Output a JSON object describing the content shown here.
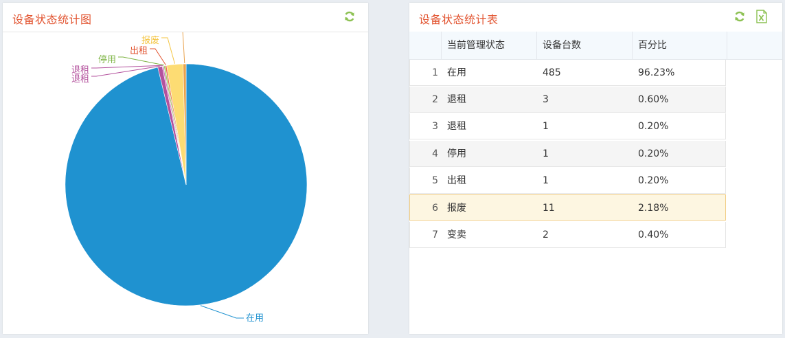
{
  "left_panel": {
    "title": "设备状态统计图",
    "refresh_icon": "refresh-icon"
  },
  "right_panel": {
    "title": "设备状态统计表",
    "refresh_icon": "refresh-icon",
    "export_icon": "excel-export-icon"
  },
  "colors": {
    "title": "#e2532f",
    "icon_green": "#8cc152",
    "slice_main": "#1f92d0"
  },
  "chart_data": {
    "type": "pie",
    "labels": [
      "在用",
      "退租",
      "退租",
      "停用",
      "出租",
      "报废",
      "变卖"
    ],
    "values": [
      485,
      3,
      1,
      1,
      1,
      11,
      2
    ],
    "colors": [
      "#1f92d0",
      "#b3519d",
      "#d37ec4",
      "#9cd160",
      "#ea6d48",
      "#fddc73",
      "#e8a24d"
    ],
    "label_colors": [
      "#1f92d0",
      "#b3519d",
      "#b3519d",
      "#7cb342",
      "#e2532f",
      "#f4c542",
      "#e8a24d"
    ]
  },
  "table": {
    "columns": [
      "当前管理状态",
      "设备台数",
      "百分比"
    ],
    "rows": [
      {
        "idx": "1",
        "status": "在用",
        "count": "485",
        "percent": "96.23%"
      },
      {
        "idx": "2",
        "status": "退租",
        "count": "3",
        "percent": "0.60%"
      },
      {
        "idx": "3",
        "status": "退租",
        "count": "1",
        "percent": "0.20%"
      },
      {
        "idx": "4",
        "status": "停用",
        "count": "1",
        "percent": "0.20%"
      },
      {
        "idx": "5",
        "status": "出租",
        "count": "1",
        "percent": "0.20%"
      },
      {
        "idx": "6",
        "status": "报废",
        "count": "11",
        "percent": "2.18%"
      },
      {
        "idx": "7",
        "status": "变卖",
        "count": "2",
        "percent": "0.40%"
      }
    ]
  }
}
